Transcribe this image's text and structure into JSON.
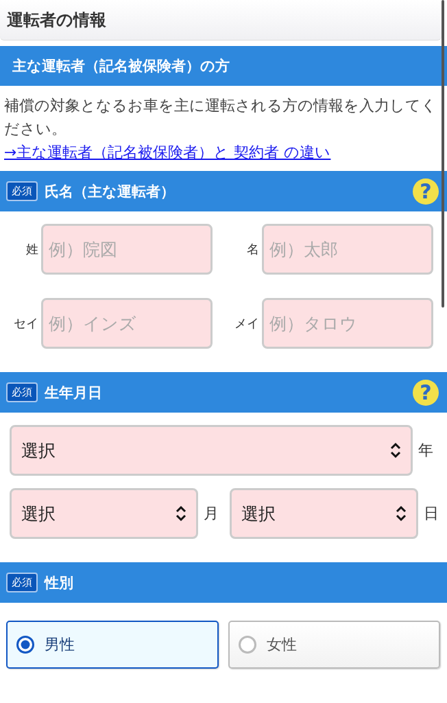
{
  "page_title": "運転者の情報",
  "section": {
    "title": "主な運転者（記名被保険者）の方",
    "description": "補償の対象となるお車を主に運転される方の情報を入力してください。",
    "link": "→主な運転者（記名被保険者）と 契約者 の違い"
  },
  "name_field": {
    "required_badge": "必須",
    "label": "氏名（主な運転者）",
    "help": "?",
    "inputs": [
      {
        "label": "姓",
        "placeholder": "例）院図"
      },
      {
        "label": "名",
        "placeholder": "例）太郎"
      },
      {
        "label": "セイ",
        "placeholder": "例）インズ"
      },
      {
        "label": "メイ",
        "placeholder": "例）タロウ"
      }
    ]
  },
  "birth_field": {
    "required_badge": "必須",
    "label": "生年月日",
    "help": "?",
    "selects": [
      {
        "value": "選択",
        "unit": "年"
      },
      {
        "value": "選択",
        "unit": "月"
      },
      {
        "value": "選択",
        "unit": "日"
      }
    ]
  },
  "gender_field": {
    "required_badge": "必須",
    "label": "性別",
    "options": [
      {
        "label": "男性",
        "selected": true
      },
      {
        "label": "女性",
        "selected": false
      }
    ]
  }
}
